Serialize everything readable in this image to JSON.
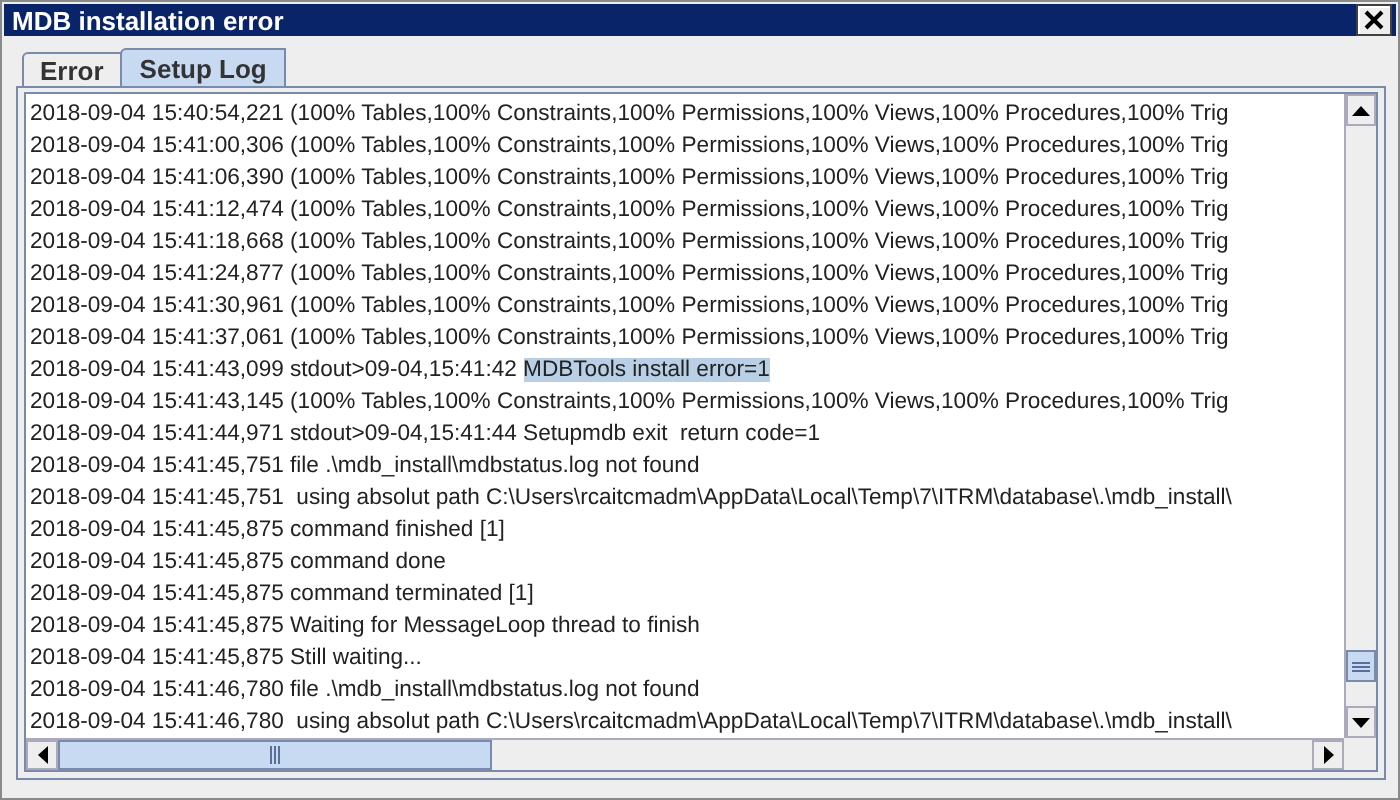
{
  "window": {
    "title": "MDB installation error"
  },
  "tabs": [
    {
      "label": "Error",
      "selected": false
    },
    {
      "label": "Setup Log",
      "selected": true
    }
  ],
  "log": {
    "lines": [
      {
        "text": "2018-09-04 15:40:54,221 (100% Tables,100% Constraints,100% Permissions,100% Views,100% Procedures,100% Trig"
      },
      {
        "text": "2018-09-04 15:41:00,306 (100% Tables,100% Constraints,100% Permissions,100% Views,100% Procedures,100% Trig"
      },
      {
        "text": "2018-09-04 15:41:06,390 (100% Tables,100% Constraints,100% Permissions,100% Views,100% Procedures,100% Trig"
      },
      {
        "text": "2018-09-04 15:41:12,474 (100% Tables,100% Constraints,100% Permissions,100% Views,100% Procedures,100% Trig"
      },
      {
        "text": "2018-09-04 15:41:18,668 (100% Tables,100% Constraints,100% Permissions,100% Views,100% Procedures,100% Trig"
      },
      {
        "text": "2018-09-04 15:41:24,877 (100% Tables,100% Constraints,100% Permissions,100% Views,100% Procedures,100% Trig"
      },
      {
        "text": "2018-09-04 15:41:30,961 (100% Tables,100% Constraints,100% Permissions,100% Views,100% Procedures,100% Trig"
      },
      {
        "text": "2018-09-04 15:41:37,061 (100% Tables,100% Constraints,100% Permissions,100% Views,100% Procedures,100% Trig"
      },
      {
        "text": "2018-09-04 15:41:43,099 stdout>09-04,15:41:42 ",
        "selected_text": "MDBTools install error=1"
      },
      {
        "text": "2018-09-04 15:41:43,145 (100% Tables,100% Constraints,100% Permissions,100% Views,100% Procedures,100% Trig"
      },
      {
        "text": "2018-09-04 15:41:44,971 stdout>09-04,15:41:44 Setupmdb exit  return code=1"
      },
      {
        "text": "2018-09-04 15:41:45,751 file .\\mdb_install\\mdbstatus.log not found"
      },
      {
        "text": "2018-09-04 15:41:45,751  using absolut path C:\\Users\\rcaitcmadm\\AppData\\Local\\Temp\\7\\ITRM\\database\\.\\mdb_install\\"
      },
      {
        "text": "2018-09-04 15:41:45,875 command finished [1]"
      },
      {
        "text": "2018-09-04 15:41:45,875 command done"
      },
      {
        "text": "2018-09-04 15:41:45,875 command terminated [1]"
      },
      {
        "text": "2018-09-04 15:41:45,875 Waiting for MessageLoop thread to finish"
      },
      {
        "text": "2018-09-04 15:41:45,875 Still waiting..."
      },
      {
        "text": "2018-09-04 15:41:46,780 file .\\mdb_install\\mdbstatus.log not found"
      },
      {
        "text": "2018-09-04 15:41:46,780  using absolut path C:\\Users\\rcaitcmadm\\AppData\\Local\\Temp\\7\\ITRM\\database\\.\\mdb_install\\"
      }
    ]
  }
}
